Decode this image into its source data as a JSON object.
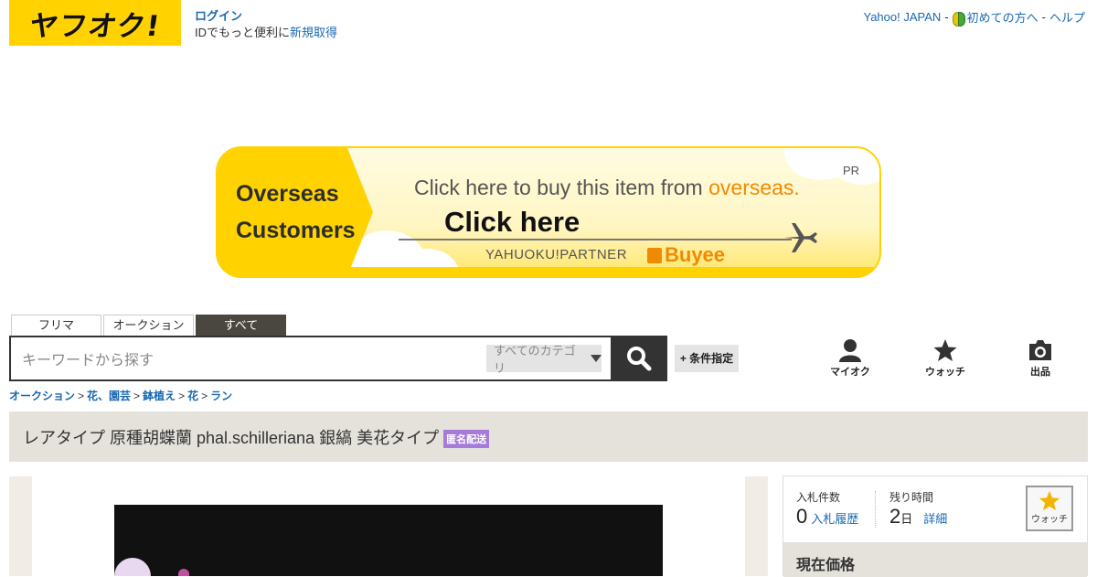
{
  "header": {
    "logo": "ヤフオク!",
    "login": "ログイン",
    "id_text": "IDでもっと便利に",
    "register": "新規取得",
    "nav": [
      "Yahoo! JAPAN",
      "初めての方へ",
      "ヘルプ"
    ]
  },
  "banner": {
    "left_line1": "Overseas",
    "left_line2": "Customers",
    "headline_prefix": "Click here to buy this item from ",
    "headline_accent": "overseas.",
    "pr": "PR",
    "click_here": "Click here",
    "partner": "YAHUOKU!PARTNER",
    "brand": "Buyee",
    "accent_color": "#ffd200"
  },
  "search": {
    "tabs": [
      "フリマ",
      "オークション",
      "すべて"
    ],
    "active_tab": "すべて",
    "placeholder": "キーワードから探す",
    "category": "すべてのカテゴリ",
    "condition": "+ 条件指定"
  },
  "tools": [
    "マイオク",
    "ウォッチ",
    "出品"
  ],
  "breadcrumb": [
    "オークション",
    "花、園芸",
    "鉢植え",
    "花",
    "ラン"
  ],
  "item": {
    "title": "レアタイプ 原種胡蝶蘭 phal.schilleriana 銀縞 美花タイプ",
    "badge": "匿名配送"
  },
  "bid": {
    "bids_label": "入札件数",
    "bids_value": "0",
    "history_link": "入札履歴",
    "time_label": "残り時間",
    "time_value": "2",
    "time_unit": "日",
    "detail_link": "詳細",
    "watch": "ウォッチ",
    "price_label": "現在価格"
  }
}
